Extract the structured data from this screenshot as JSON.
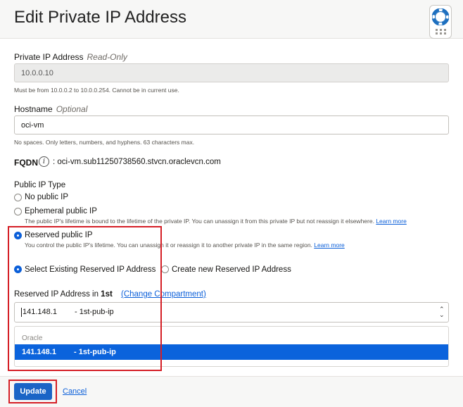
{
  "dialog": {
    "title": "Edit Private IP Address"
  },
  "help_button": {
    "icon": "lifebuoy-icon",
    "grip_icon": "drag-grip-icon"
  },
  "private_ip": {
    "label": "Private IP Address",
    "qualifier": "Read-Only",
    "value": "10.0.0.10",
    "help": "Must be from 10.0.0.2 to 10.0.0.254. Cannot be in current use."
  },
  "hostname": {
    "label": "Hostname",
    "qualifier": "Optional",
    "value": "oci-vm",
    "help": "No spaces. Only letters, numbers, and hyphens. 63 characters max."
  },
  "fqdn": {
    "label": "FQDN",
    "info_glyph": "i",
    "value": ": oci-vm.sub11250738560.stvcn.oraclevcn.com"
  },
  "public_ip_type": {
    "label": "Public IP Type",
    "options": [
      {
        "label": "No public IP",
        "selected": false,
        "help": ""
      },
      {
        "label": "Ephemeral public IP",
        "selected": false,
        "help": "The public IP's lifetime is bound to the lifetime of the private IP. You can unassign it from this private IP but not reassign it elsewhere.",
        "link": "Learn more"
      },
      {
        "label": "Reserved public IP",
        "selected": true,
        "help": "You control the public IP's lifetime. You can unassign it or reassign it to another private IP in the same region.",
        "link": "Learn more"
      }
    ]
  },
  "reserved_source": {
    "options": [
      {
        "label": "Select Existing Reserved IP Address",
        "selected": true
      },
      {
        "label": "Create new Reserved IP Address",
        "selected": false
      }
    ]
  },
  "reserved_ip": {
    "label_prefix": "Reserved IP Address in ",
    "compartment": "1st",
    "change_link": "(Change Compartment)",
    "selected_ip": "141.148.1",
    "selected_name": "- 1st-pub-ip",
    "dropdown_group": "Oracle",
    "dropdown_options": [
      {
        "ip": "141.148.1",
        "name": "- 1st-pub-ip",
        "highlighted": true
      }
    ]
  },
  "footer": {
    "update_label": "Update",
    "cancel_label": "Cancel"
  },
  "colors": {
    "accent": "#0b5fd9",
    "highlight_border": "#d51f26",
    "selected_option": "#0b63dc"
  }
}
